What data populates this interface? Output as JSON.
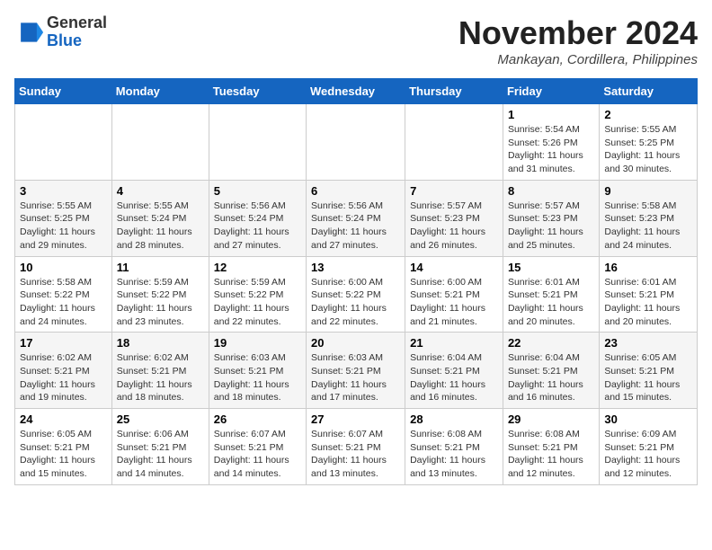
{
  "logo": {
    "general": "General",
    "blue": "Blue"
  },
  "header": {
    "month": "November 2024",
    "location": "Mankayan, Cordillera, Philippines"
  },
  "days_of_week": [
    "Sunday",
    "Monday",
    "Tuesday",
    "Wednesday",
    "Thursday",
    "Friday",
    "Saturday"
  ],
  "weeks": [
    [
      {
        "day": "",
        "info": ""
      },
      {
        "day": "",
        "info": ""
      },
      {
        "day": "",
        "info": ""
      },
      {
        "day": "",
        "info": ""
      },
      {
        "day": "",
        "info": ""
      },
      {
        "day": "1",
        "info": "Sunrise: 5:54 AM\nSunset: 5:26 PM\nDaylight: 11 hours and 31 minutes."
      },
      {
        "day": "2",
        "info": "Sunrise: 5:55 AM\nSunset: 5:25 PM\nDaylight: 11 hours and 30 minutes."
      }
    ],
    [
      {
        "day": "3",
        "info": "Sunrise: 5:55 AM\nSunset: 5:25 PM\nDaylight: 11 hours and 29 minutes."
      },
      {
        "day": "4",
        "info": "Sunrise: 5:55 AM\nSunset: 5:24 PM\nDaylight: 11 hours and 28 minutes."
      },
      {
        "day": "5",
        "info": "Sunrise: 5:56 AM\nSunset: 5:24 PM\nDaylight: 11 hours and 27 minutes."
      },
      {
        "day": "6",
        "info": "Sunrise: 5:56 AM\nSunset: 5:24 PM\nDaylight: 11 hours and 27 minutes."
      },
      {
        "day": "7",
        "info": "Sunrise: 5:57 AM\nSunset: 5:23 PM\nDaylight: 11 hours and 26 minutes."
      },
      {
        "day": "8",
        "info": "Sunrise: 5:57 AM\nSunset: 5:23 PM\nDaylight: 11 hours and 25 minutes."
      },
      {
        "day": "9",
        "info": "Sunrise: 5:58 AM\nSunset: 5:23 PM\nDaylight: 11 hours and 24 minutes."
      }
    ],
    [
      {
        "day": "10",
        "info": "Sunrise: 5:58 AM\nSunset: 5:22 PM\nDaylight: 11 hours and 24 minutes."
      },
      {
        "day": "11",
        "info": "Sunrise: 5:59 AM\nSunset: 5:22 PM\nDaylight: 11 hours and 23 minutes."
      },
      {
        "day": "12",
        "info": "Sunrise: 5:59 AM\nSunset: 5:22 PM\nDaylight: 11 hours and 22 minutes."
      },
      {
        "day": "13",
        "info": "Sunrise: 6:00 AM\nSunset: 5:22 PM\nDaylight: 11 hours and 22 minutes."
      },
      {
        "day": "14",
        "info": "Sunrise: 6:00 AM\nSunset: 5:21 PM\nDaylight: 11 hours and 21 minutes."
      },
      {
        "day": "15",
        "info": "Sunrise: 6:01 AM\nSunset: 5:21 PM\nDaylight: 11 hours and 20 minutes."
      },
      {
        "day": "16",
        "info": "Sunrise: 6:01 AM\nSunset: 5:21 PM\nDaylight: 11 hours and 20 minutes."
      }
    ],
    [
      {
        "day": "17",
        "info": "Sunrise: 6:02 AM\nSunset: 5:21 PM\nDaylight: 11 hours and 19 minutes."
      },
      {
        "day": "18",
        "info": "Sunrise: 6:02 AM\nSunset: 5:21 PM\nDaylight: 11 hours and 18 minutes."
      },
      {
        "day": "19",
        "info": "Sunrise: 6:03 AM\nSunset: 5:21 PM\nDaylight: 11 hours and 18 minutes."
      },
      {
        "day": "20",
        "info": "Sunrise: 6:03 AM\nSunset: 5:21 PM\nDaylight: 11 hours and 17 minutes."
      },
      {
        "day": "21",
        "info": "Sunrise: 6:04 AM\nSunset: 5:21 PM\nDaylight: 11 hours and 16 minutes."
      },
      {
        "day": "22",
        "info": "Sunrise: 6:04 AM\nSunset: 5:21 PM\nDaylight: 11 hours and 16 minutes."
      },
      {
        "day": "23",
        "info": "Sunrise: 6:05 AM\nSunset: 5:21 PM\nDaylight: 11 hours and 15 minutes."
      }
    ],
    [
      {
        "day": "24",
        "info": "Sunrise: 6:05 AM\nSunset: 5:21 PM\nDaylight: 11 hours and 15 minutes."
      },
      {
        "day": "25",
        "info": "Sunrise: 6:06 AM\nSunset: 5:21 PM\nDaylight: 11 hours and 14 minutes."
      },
      {
        "day": "26",
        "info": "Sunrise: 6:07 AM\nSunset: 5:21 PM\nDaylight: 11 hours and 14 minutes."
      },
      {
        "day": "27",
        "info": "Sunrise: 6:07 AM\nSunset: 5:21 PM\nDaylight: 11 hours and 13 minutes."
      },
      {
        "day": "28",
        "info": "Sunrise: 6:08 AM\nSunset: 5:21 PM\nDaylight: 11 hours and 13 minutes."
      },
      {
        "day": "29",
        "info": "Sunrise: 6:08 AM\nSunset: 5:21 PM\nDaylight: 11 hours and 12 minutes."
      },
      {
        "day": "30",
        "info": "Sunrise: 6:09 AM\nSunset: 5:21 PM\nDaylight: 11 hours and 12 minutes."
      }
    ]
  ]
}
